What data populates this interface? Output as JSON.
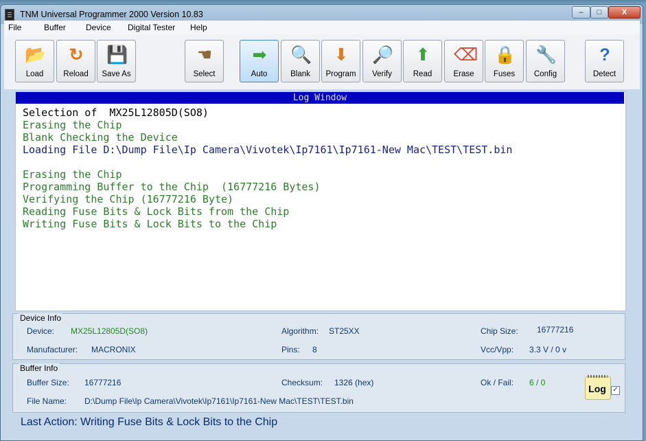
{
  "app": {
    "title": "TNM  Universal Programmer 2000   Version 10.83"
  },
  "window_controls": {
    "minimize": "–",
    "maximize": "□",
    "close": "X"
  },
  "menu": [
    "File",
    "Buffer",
    "Device",
    "Digital Tester",
    "Help"
  ],
  "toolbar": [
    {
      "label": "Load",
      "icon": "folder-open-icon",
      "glyph": "📂"
    },
    {
      "label": "Reload",
      "icon": "reload-icon",
      "glyph": "↻"
    },
    {
      "label": "Save As",
      "icon": "floppy-icon",
      "glyph": "💾"
    },
    {
      "label": "Select",
      "icon": "chip-select-icon",
      "glyph": "☚"
    },
    {
      "label": "Auto",
      "icon": "arrow-right-icon",
      "glyph": "➡"
    },
    {
      "label": "Blank",
      "icon": "magnifier-icon",
      "glyph": "🔍"
    },
    {
      "label": "Program",
      "icon": "download-arrow-icon",
      "glyph": "⬇"
    },
    {
      "label": "Verify",
      "icon": "verify-magnifier-icon",
      "glyph": "🔎"
    },
    {
      "label": "Read",
      "icon": "read-arrow-icon",
      "glyph": "⬆"
    },
    {
      "label": "Erase",
      "icon": "eraser-icon",
      "glyph": "⌫"
    },
    {
      "label": "Fuses",
      "icon": "padlock-icon",
      "glyph": "🔒"
    },
    {
      "label": "Config",
      "icon": "tools-icon",
      "glyph": "🔧"
    },
    {
      "label": "Detect",
      "icon": "chip-question-icon",
      "glyph": "?"
    }
  ],
  "active_toolbar_button": "Auto",
  "log": {
    "header": "Log Window",
    "lines": [
      {
        "text": "Selection of  MX25L12805D(SO8)",
        "color": "#000000"
      },
      {
        "text": "Erasing the Chip",
        "color": "#2e7d2e"
      },
      {
        "text": "Blank Checking the Device",
        "color": "#2e7d2e"
      },
      {
        "text": "Loading File D:\\Dump File\\Ip Camera\\Vivotek\\Ip7161\\Ip7161-New Mac\\TEST\\TEST.bin",
        "color": "#1a237e"
      },
      {
        "text": "",
        "color": "#000000"
      },
      {
        "text": "Erasing the Chip",
        "color": "#2e7d2e"
      },
      {
        "text": "Programming Buffer to the Chip  (16777216 Bytes)",
        "color": "#2e7d2e"
      },
      {
        "text": "Verifying the Chip (16777216 Byte)",
        "color": "#2e7d2e"
      },
      {
        "text": "Reading Fuse Bits & Lock Bits from the Chip",
        "color": "#2e7d2e"
      },
      {
        "text": "Writing Fuse Bits & Lock Bits to the Chip",
        "color": "#2e7d2e"
      }
    ]
  },
  "device_info": {
    "title": "Device Info",
    "device_label": "Device:",
    "device_value": "MX25L12805D(SO8)",
    "algorithm_label": "Algorithm:",
    "algorithm_value": "ST25XX",
    "chip_size_label": "Chip Size:",
    "chip_size_value": "16777216",
    "manufacturer_label": "Manufacturer:",
    "manufacturer_value": "MACRONIX",
    "pins_label": "Pins:",
    "pins_value": "8",
    "vcc_label": "Vcc/Vpp:",
    "vcc_value": "3.3 V / 0 v"
  },
  "buffer_info": {
    "title": "Buffer Info",
    "size_label": "Buffer Size:",
    "size_value": "16777216",
    "checksum_label": "Checksum:",
    "checksum_value": "1326 (hex)",
    "okfail_label": "Ok / Fail:",
    "okfail_value": "6 / 0",
    "filename_label": "File Name:",
    "filename_value": "D:\\Dump File\\Ip Camera\\Vivotek\\Ip7161\\Ip7161-New Mac\\TEST\\TEST.bin",
    "log_label": "Log",
    "log_checked": true
  },
  "last_action": "Last Action:  Writing Fuse Bits & Lock Bits to the Chip",
  "colors": {
    "green_value": "#1b8a1b",
    "blue_value": "#103a6a",
    "log_header_bg": "#0000c0"
  }
}
